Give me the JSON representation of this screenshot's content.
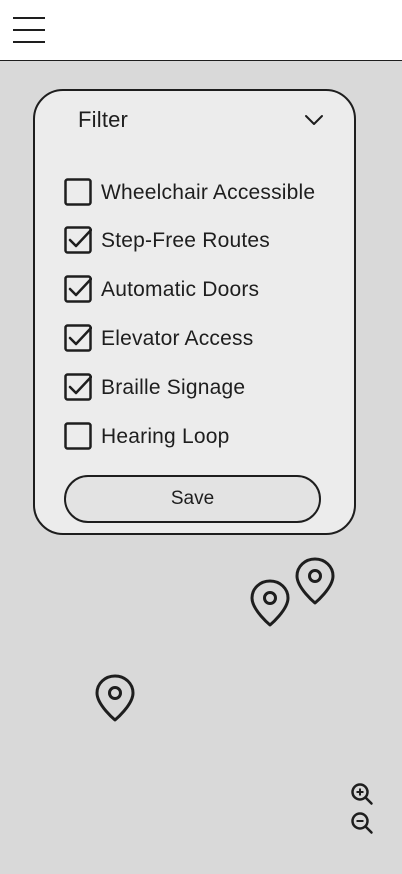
{
  "filter": {
    "title": "Filter",
    "options": [
      {
        "label": "Wheelchair Accessible",
        "checked": false
      },
      {
        "label": "Step-Free Routes",
        "checked": true
      },
      {
        "label": "Automatic Doors",
        "checked": true
      },
      {
        "label": "Elevator Access",
        "checked": true
      },
      {
        "label": "Braille Signage",
        "checked": true
      },
      {
        "label": "Hearing Loop",
        "checked": false
      }
    ],
    "save_label": "Save"
  },
  "map": {
    "pins": [
      "map-pin-icon",
      "map-pin-icon",
      "map-pin-icon"
    ],
    "zoom_in_icon": "zoom-in-icon",
    "zoom_out_icon": "zoom-out-icon"
  },
  "colors": {
    "background": "#d9d9d9",
    "panel": "#ececec",
    "stroke": "#1e1e1e",
    "top_bar": "#ffffff"
  }
}
